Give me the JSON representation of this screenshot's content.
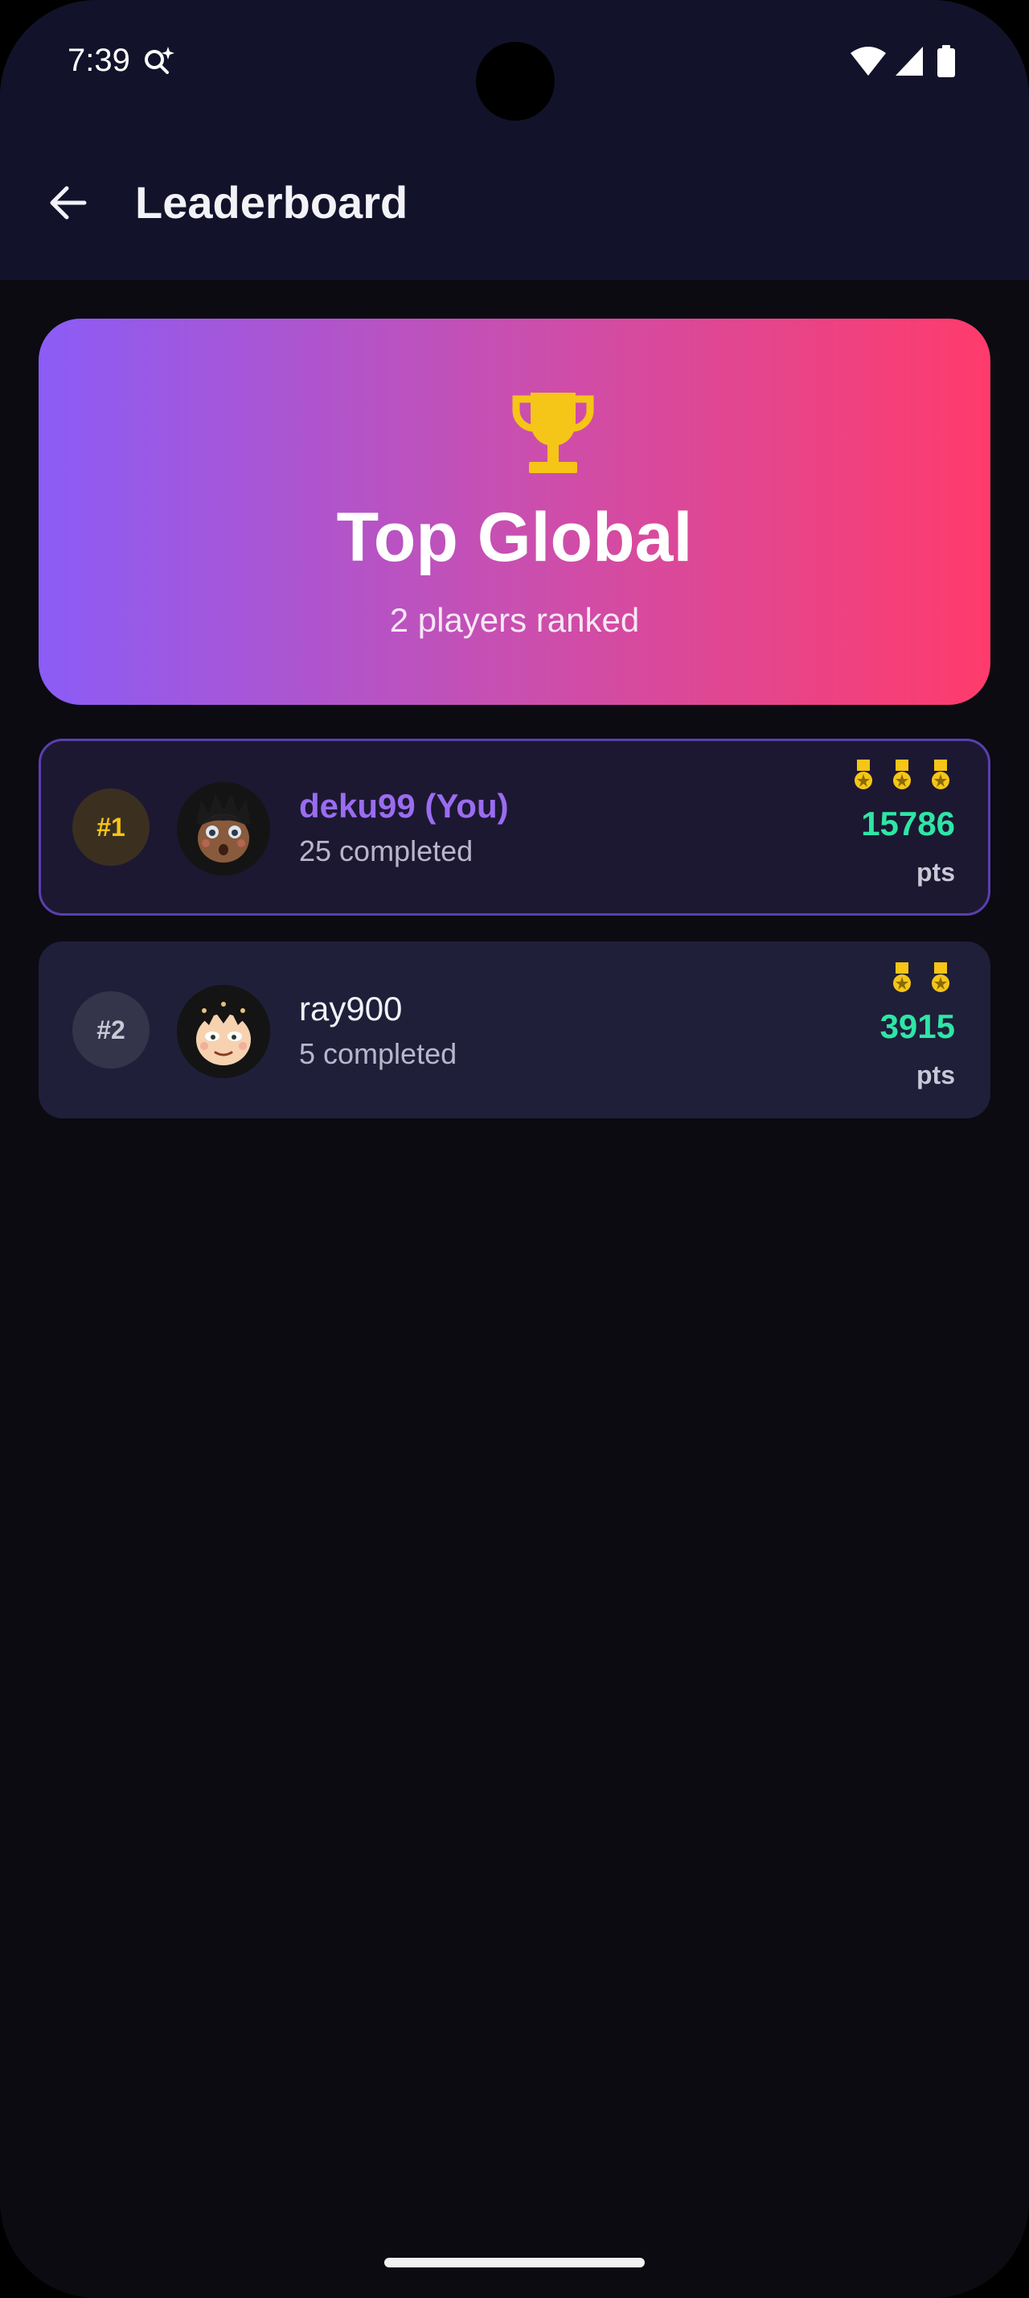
{
  "status_bar": {
    "time": "7:39",
    "icons": [
      "search-sparkle-icon",
      "wifi-icon",
      "signal-icon",
      "battery-icon"
    ]
  },
  "header": {
    "back_icon": "arrow-left-icon",
    "title": "Leaderboard"
  },
  "hero": {
    "icon": "trophy-icon",
    "title": "Top Global",
    "subtitle": "2 players ranked",
    "gradient": [
      "#8b5cf6",
      "#ff3b6b"
    ]
  },
  "players": [
    {
      "rank": "#1",
      "name": "deku99 (You)",
      "completed": "25 completed",
      "medals": 3,
      "points": "15786",
      "points_unit": "pts",
      "is_you": true
    },
    {
      "rank": "#2",
      "name": "ray900",
      "completed": "5 completed",
      "medals": 2,
      "points": "3915",
      "points_unit": "pts",
      "is_you": false
    }
  ],
  "colors": {
    "accent_you": "#9b6cf0",
    "points": "#2ee6a6",
    "gold": "#f5c518"
  }
}
